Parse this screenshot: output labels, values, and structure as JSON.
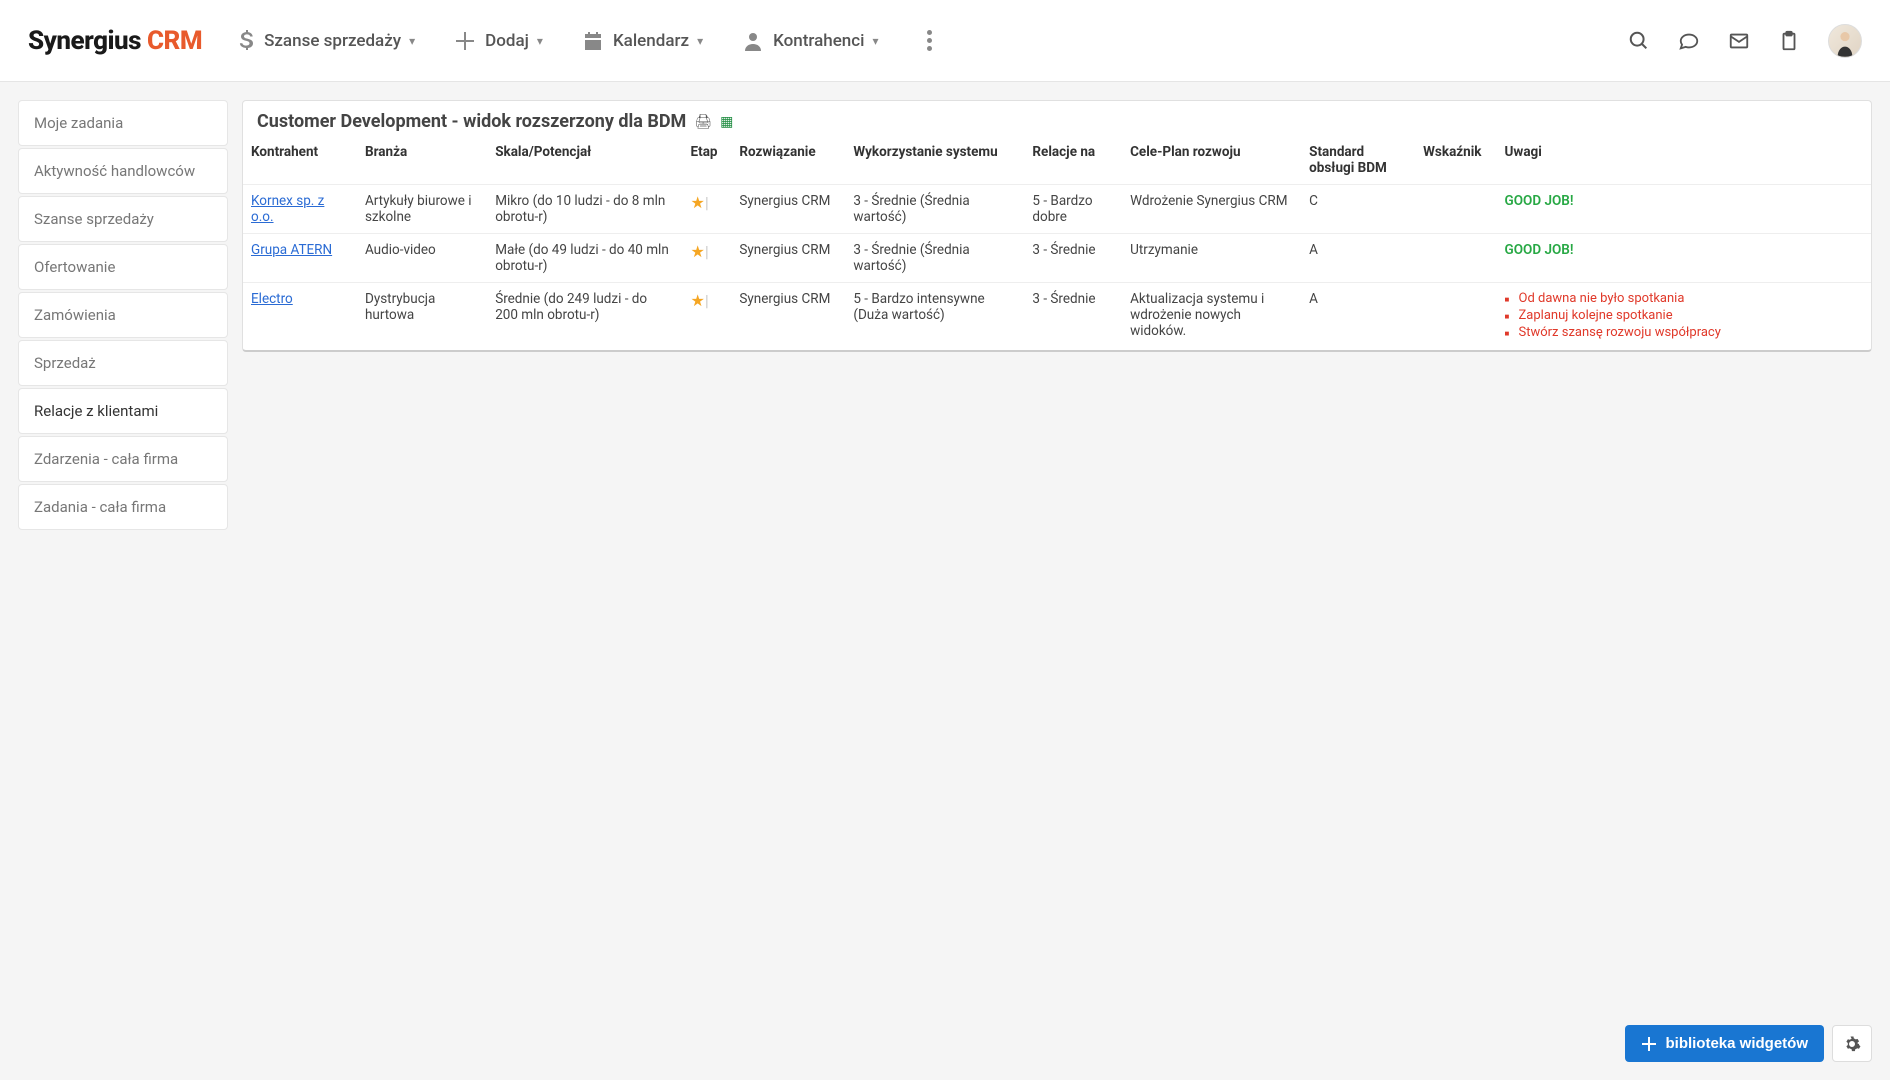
{
  "brand": {
    "name": "Synergius",
    "suffix": "CRM"
  },
  "nav": {
    "szanse": "Szanse sprzedaży",
    "dodaj": "Dodaj",
    "kalendarz": "Kalendarz",
    "kontrahenci": "Kontrahenci"
  },
  "sidebar": [
    "Moje zadania",
    "Aktywność handlowców",
    "Szanse sprzedaży",
    "Ofertowanie",
    "Zamówienia",
    "Sprzedaż",
    "Relacje z klientami",
    "Zdarzenia - cała firma",
    "Zadania - cała firma"
  ],
  "panel": {
    "title": "Customer Development - widok rozszerzony dla BDM",
    "columns": {
      "kontrahent": "Kontrahent",
      "branza": "Branża",
      "skala": "Skala/Potencjał",
      "etap": "Etap",
      "rozwiazanie": "Rozwiązanie",
      "wykorzystanie": "Wykorzystanie systemu",
      "relacje": "Relacje na",
      "cele": "Cele-Plan rozwoju",
      "standard": "Standard obsługi BDM",
      "wskaznik": "Wskaźnik",
      "uwagi": "Uwagi"
    },
    "rows": [
      {
        "kontrahent": "Kornex sp. z o.o.",
        "branza": "Artykuły biurowe i szkolne",
        "skala": "Mikro (do 10 ludzi - do 8 mln obrotu-r)",
        "rozwiazanie": "Synergius CRM",
        "wykorzystanie": "3 - Średnie (Średnia wartość)",
        "relacje": "5 - Bardzo dobre",
        "cele": "Wdrożenie Synergius CRM",
        "standard": "C",
        "wskaznik": "",
        "uwagi_good": "GOOD JOB!",
        "uwagi_list": []
      },
      {
        "kontrahent": "Grupa ATERN",
        "branza": "Audio-video",
        "skala": "Małe (do 49 ludzi - do 40 mln obrotu-r)",
        "rozwiazanie": "Synergius CRM",
        "wykorzystanie": "3 - Średnie (Średnia wartość)",
        "relacje": "3 - Średnie",
        "cele": "Utrzymanie",
        "standard": "A",
        "wskaznik": "",
        "uwagi_good": "GOOD JOB!",
        "uwagi_list": []
      },
      {
        "kontrahent": "Electro",
        "branza": "Dystrybucja hurtowa",
        "skala": "Średnie (do 249 ludzi - do 200 mln obrotu-r)",
        "rozwiazanie": "Synergius CRM",
        "wykorzystanie": "5 - Bardzo intensywne (Duża wartość)",
        "relacje": "3 - Średnie",
        "cele": "Aktualizacja systemu i wdrożenie nowych widoków.",
        "standard": "A",
        "wskaznik": "",
        "uwagi_good": "",
        "uwagi_list": [
          "Od dawna nie było spotkania",
          "Zaplanuj kolejne spotkanie",
          "Stwórz szansę rozwoju współpracy"
        ]
      }
    ]
  },
  "fab": {
    "label": "biblioteka widgetów"
  }
}
